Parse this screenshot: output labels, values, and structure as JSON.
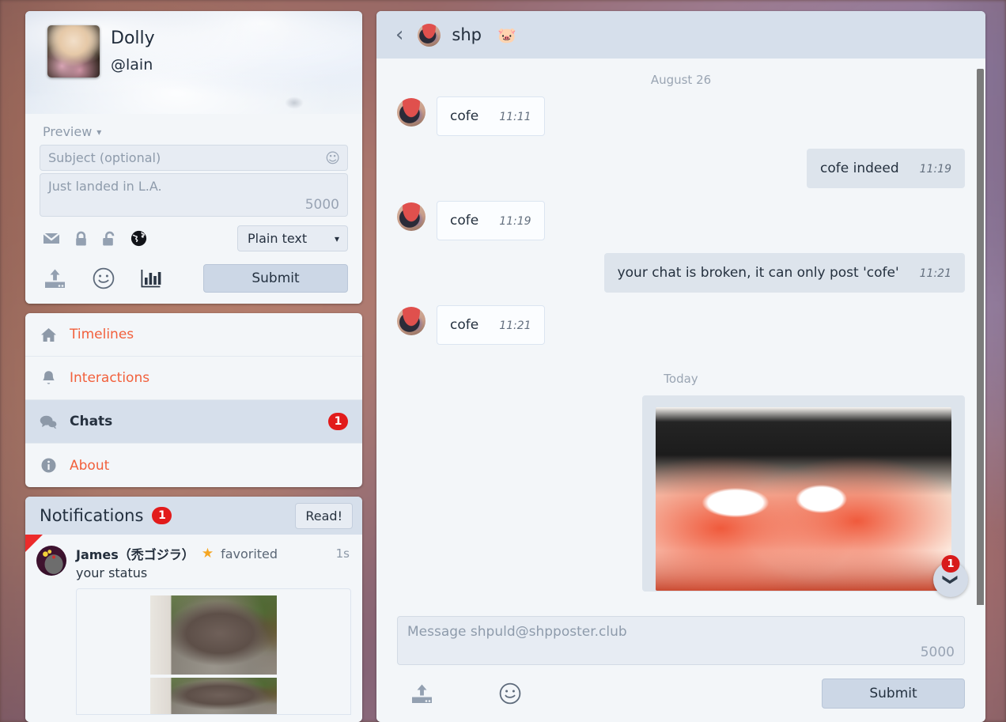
{
  "user": {
    "display_name": "Dolly",
    "handle": "@lain",
    "avatar_name": "user-avatar"
  },
  "composer": {
    "preview_label": "Preview",
    "subject_placeholder": "Subject (optional)",
    "body_placeholder": "Just landed in L.A.",
    "char_counter": "5000",
    "scope_icons": [
      {
        "name": "envelope-icon",
        "title": "Direct"
      },
      {
        "name": "lock-closed-icon",
        "title": "Private"
      },
      {
        "name": "lock-open-icon",
        "title": "Unlisted"
      },
      {
        "name": "globe-icon",
        "title": "Public"
      }
    ],
    "format_selected": "Plain text",
    "action_icons": [
      {
        "name": "upload-icon"
      },
      {
        "name": "emoji-icon"
      },
      {
        "name": "poll-icon"
      }
    ],
    "submit_label": "Submit"
  },
  "nav": {
    "items": [
      {
        "label": "Timelines",
        "icon": "home-icon",
        "active": false,
        "badge": ""
      },
      {
        "label": "Interactions",
        "icon": "bell-icon",
        "active": false,
        "badge": ""
      },
      {
        "label": "Chats",
        "icon": "chat-bubbles-icon",
        "active": true,
        "badge": "1"
      },
      {
        "label": "About",
        "icon": "info-icon",
        "active": false,
        "badge": ""
      }
    ]
  },
  "notifications": {
    "title": "Notifications",
    "badge": "1",
    "read_button": "Read!",
    "items": [
      {
        "user": "James（禿ゴジラ）",
        "action": "favorited",
        "time": "1s",
        "status": "your status",
        "star_glyph": "★",
        "unread": true
      }
    ]
  },
  "chat": {
    "back_icon": "chevron-left-icon",
    "title": "shp",
    "title_emoji": "🐷",
    "messages": [
      {
        "type": "day",
        "label": "August 26"
      },
      {
        "type": "in",
        "text": "cofe",
        "time": "11:11"
      },
      {
        "type": "out",
        "text": "cofe indeed",
        "time": "11:19"
      },
      {
        "type": "in",
        "text": "cofe",
        "time": "11:19"
      },
      {
        "type": "out",
        "text": "your chat is broken, it can only post 'cofe'",
        "time": "11:21"
      },
      {
        "type": "in",
        "text": "cofe",
        "time": "11:21"
      },
      {
        "type": "day",
        "label": "Today"
      },
      {
        "type": "out-media",
        "text": "",
        "time": "",
        "media_name": "chat-attachment-image"
      }
    ],
    "scroll_fab": {
      "icon": "chevron-down-icon",
      "badge": "1"
    },
    "composer": {
      "placeholder": "Message shpuld@shpposter.club",
      "char_counter": "5000",
      "action_icons": [
        {
          "name": "upload-icon"
        },
        {
          "name": "emoji-icon"
        }
      ],
      "submit_label": "Submit"
    }
  },
  "colors": {
    "accent_orange": "#f2603c",
    "badge_red": "#e21b1b",
    "panel_bg": "#f3f6f9",
    "header_bg": "#d6dfeb",
    "bubble_out": "#dde4ec",
    "star_gold": "#f5a623"
  }
}
